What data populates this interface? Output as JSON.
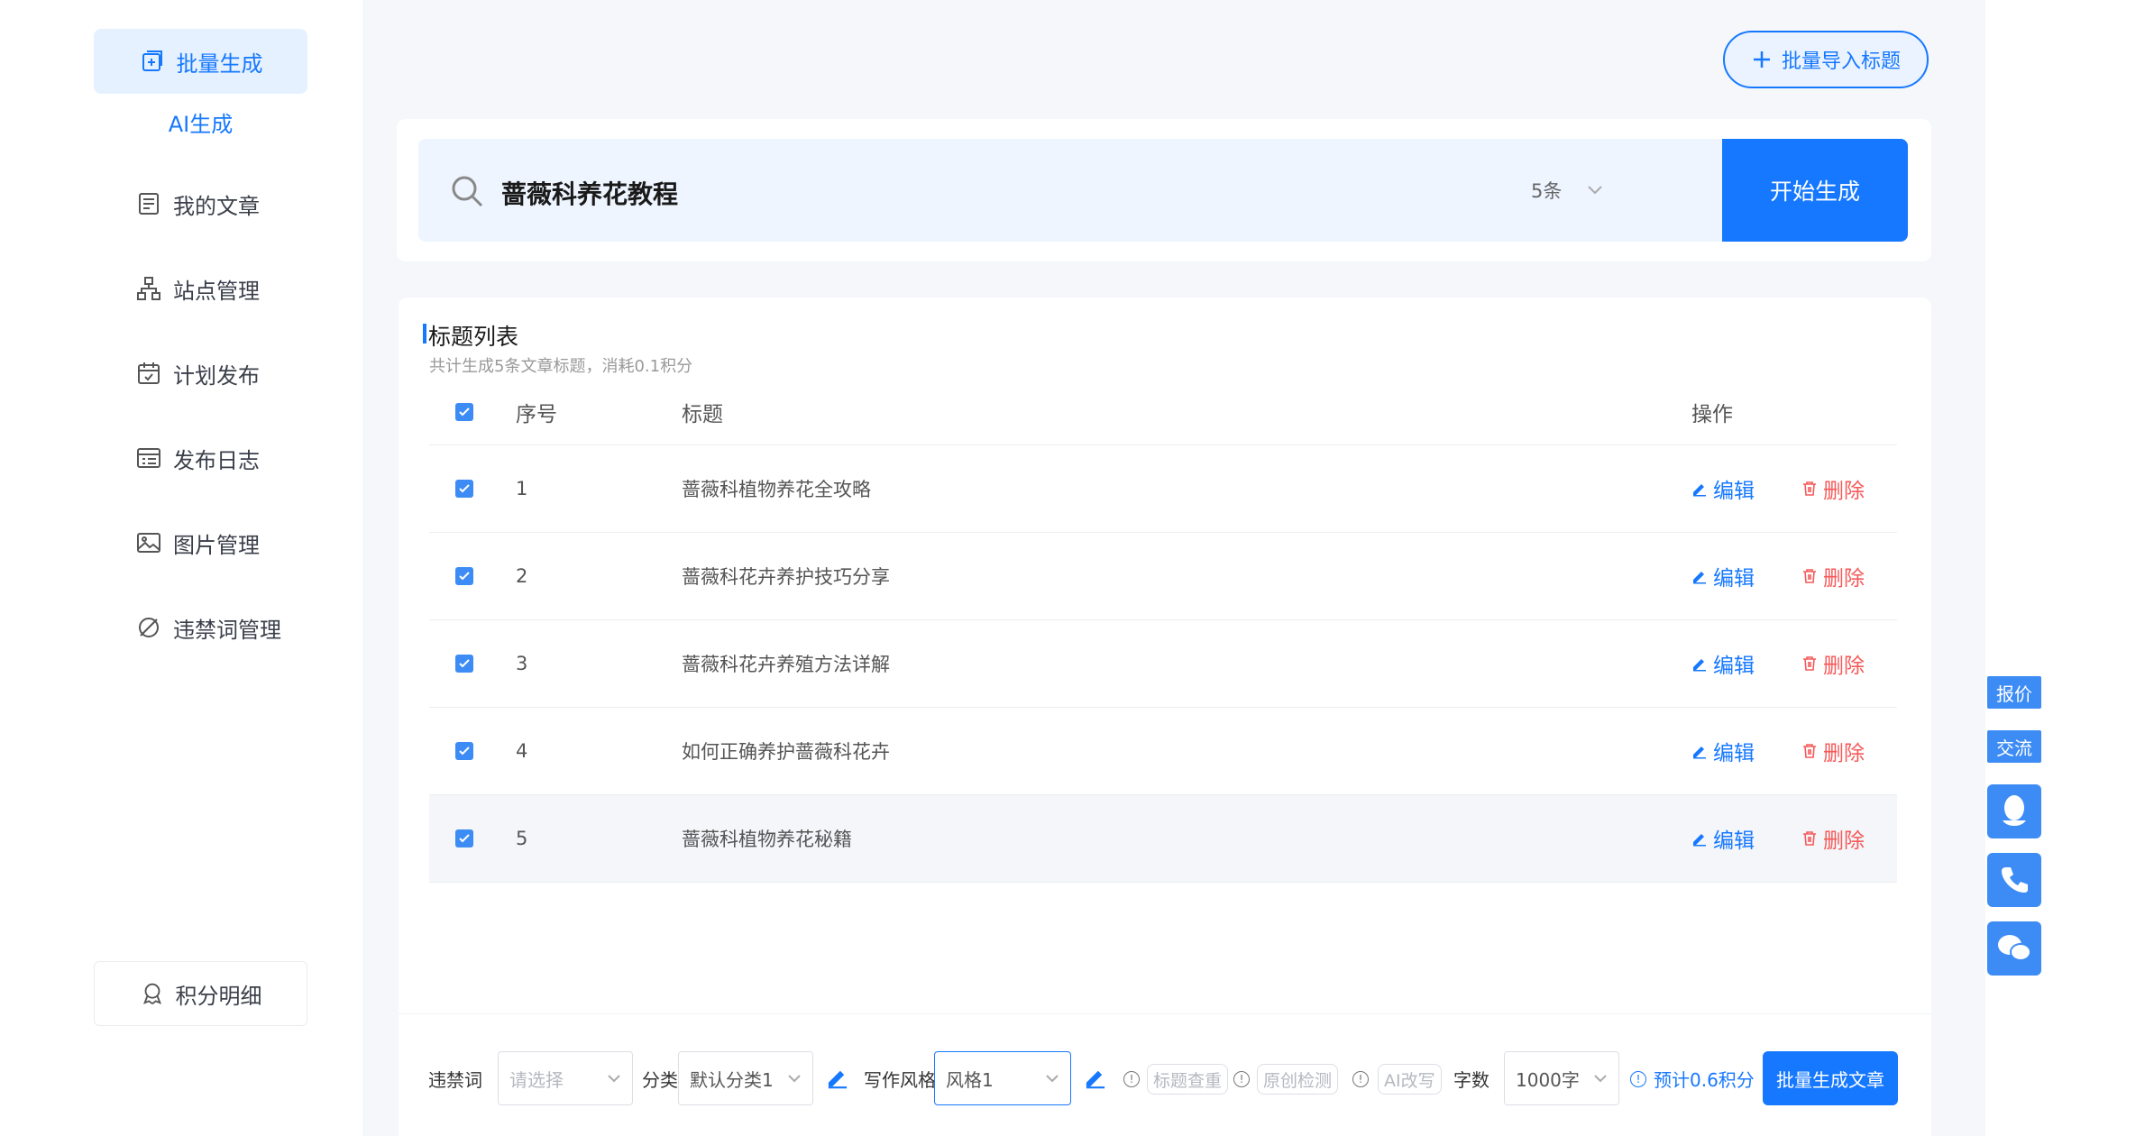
{
  "sidebar": {
    "active": "批量生成",
    "active_sub": "AI生成",
    "items": [
      {
        "label": "我的文章",
        "icon": "article-icon"
      },
      {
        "label": "站点管理",
        "icon": "sitemap-icon"
      },
      {
        "label": "计划发布",
        "icon": "calendar-icon"
      },
      {
        "label": "发布日志",
        "icon": "log-icon"
      },
      {
        "label": "图片管理",
        "icon": "image-icon"
      },
      {
        "label": "违禁词管理",
        "icon": "forbidden-icon"
      }
    ],
    "points": "积分明细"
  },
  "header": {
    "import_label": "批量导入标题"
  },
  "search": {
    "value": "蔷薇科养花教程",
    "count": "5条",
    "start_label": "开始生成"
  },
  "list": {
    "title": "标题列表",
    "subtitle": "共计生成5条文章标题，消耗0.1积分",
    "columns": {
      "num": "序号",
      "title": "标题",
      "ops": "操作"
    },
    "edit_label": "编辑",
    "delete_label": "删除",
    "rows": [
      {
        "num": "1",
        "title": "蔷薇科植物养花全攻略"
      },
      {
        "num": "2",
        "title": "蔷薇科花卉养护技巧分享"
      },
      {
        "num": "3",
        "title": "蔷薇科花卉养殖方法详解"
      },
      {
        "num": "4",
        "title": "如何正确养护蔷薇科花卉"
      },
      {
        "num": "5",
        "title": "蔷薇科植物养花秘籍"
      }
    ]
  },
  "bottom": {
    "forbidden_label": "违禁词",
    "forbidden_placeholder": "请选择",
    "category_label": "分类",
    "category_value": "默认分类1",
    "style_label": "写作风格",
    "style_value": "风格1",
    "check_title": "标题查重",
    "check_original": "原创检测",
    "ai_rewrite": "AI改写",
    "words_label": "字数",
    "words_value": "1000字",
    "estimate": "预计0.6积分",
    "batch_label": "批量生成文章"
  },
  "float": {
    "quote": "报价",
    "chat": "交流"
  },
  "colors": {
    "accent": "#1678ff",
    "danger": "#f55a5a",
    "bg": "#f5f7fa"
  }
}
